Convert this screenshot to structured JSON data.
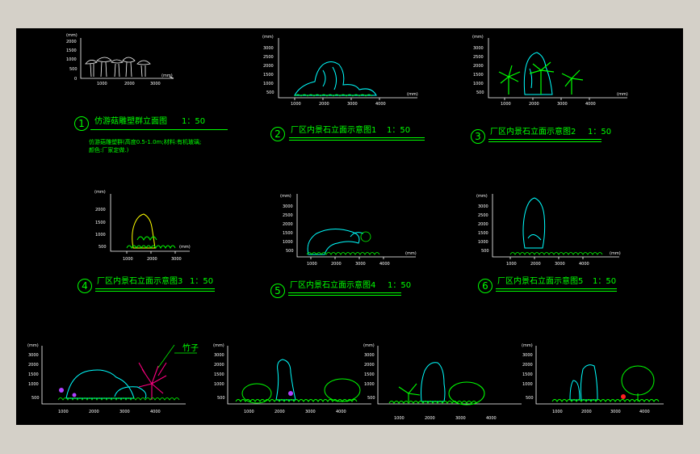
{
  "colors": {
    "background": "#000000",
    "accent": "#00ff00",
    "axis": "#ffffff",
    "rock": "#00ffff"
  },
  "drawings": [
    {
      "num": "1",
      "title": "仿游菇雕塑群立面图",
      "scale": "1：50",
      "note1": "仿游菇雕塑群(高度0.5-1.0m;材料:有机玻璃;",
      "note2": "颜色:厂家定做.)",
      "yunit": "(mm)",
      "xunit": "(mm)",
      "yticks": [
        "2000",
        "1500",
        "1000",
        "500",
        "0"
      ],
      "xticks": [
        "1000",
        "2000",
        "3000"
      ]
    },
    {
      "num": "2",
      "title": "厂区内景石立面示意图1",
      "scale": "1：50",
      "yunit": "(mm)",
      "xunit": "(mm)",
      "yticks": [
        "3000",
        "2500",
        "2000",
        "1500",
        "1000",
        "500"
      ],
      "xticks": [
        "1000",
        "2000",
        "3000",
        "4000"
      ]
    },
    {
      "num": "3",
      "title": "厂区内景石立面示意图2",
      "scale": "1：50",
      "yunit": "(mm)",
      "xunit": "(mm)",
      "yticks": [
        "3000",
        "2500",
        "2000",
        "1500",
        "1000",
        "500"
      ],
      "xticks": [
        "1000",
        "2000",
        "3000",
        "4000"
      ]
    },
    {
      "num": "4",
      "title": "厂区内景石立面示意图3",
      "scale": "1：50",
      "yunit": "(mm)",
      "xunit": "(mm)",
      "yticks": [
        "2000",
        "1500",
        "1000",
        "500"
      ],
      "xticks": [
        "1000",
        "2000",
        "3000"
      ]
    },
    {
      "num": "5",
      "title": "厂区内景石立面示意图4",
      "scale": "1：50",
      "yunit": "(mm)",
      "xunit": "(mm)",
      "yticks": [
        "3000",
        "2500",
        "2000",
        "1500",
        "1000",
        "500"
      ],
      "xticks": [
        "1000",
        "2000",
        "3000",
        "4000"
      ]
    },
    {
      "num": "6",
      "title": "厂区内景石立面示意图5",
      "scale": "1：50",
      "yunit": "(mm)",
      "xunit": "(mm)",
      "yticks": [
        "3000",
        "2500",
        "2000",
        "1500",
        "1000",
        "500"
      ],
      "xticks": [
        "1000",
        "2000",
        "3000",
        "4000"
      ]
    }
  ],
  "bottom": {
    "bamboo_label": "竹子",
    "yunit": "(mm)",
    "yticks": [
      "3000",
      "2500",
      "2000",
      "1500",
      "1000",
      "500"
    ],
    "xticks": [
      "1000",
      "2000",
      "3000",
      "4000"
    ]
  }
}
